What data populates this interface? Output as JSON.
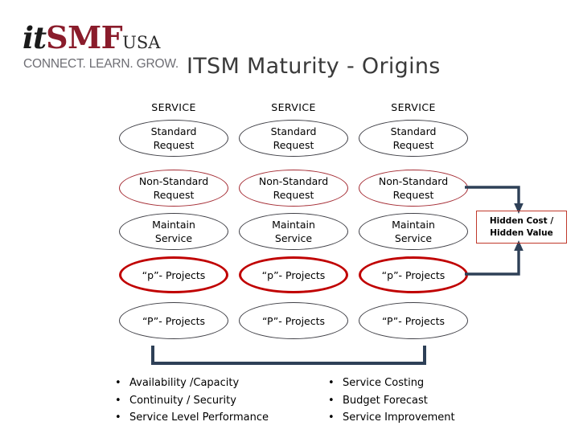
{
  "logo": {
    "part_it": "it",
    "part_smf": "SMF",
    "part_usa": "USA",
    "tagline": "CONNECT. LEARN. GROW.",
    "color_it": "#1a1a1a",
    "color_smf": "#8a1c2b",
    "color_tagline": "#6e6e74"
  },
  "title": "ITSM Maturity - Origins",
  "columns": [
    {
      "header": "SERVICE"
    },
    {
      "header": "SERVICE"
    },
    {
      "header": "SERVICE"
    }
  ],
  "rows": [
    {
      "style": "thin-black",
      "line1": "Standard",
      "line2": "Request"
    },
    {
      "style": "thin-red",
      "line1": "Non-Standard",
      "line2": "Request"
    },
    {
      "style": "thin-black",
      "line1": "Maintain",
      "line2": "Service"
    },
    {
      "style": "thick-red",
      "line1": "“p”- Projects",
      "line2": ""
    },
    {
      "style": "thin-black",
      "line1": "“P”- Projects",
      "line2": ""
    }
  ],
  "callout": {
    "line1": "Hidden Cost /",
    "line2": "Hidden Value",
    "border_color": "#c0392b"
  },
  "connector_color": "#2e4057",
  "bullets_left": [
    "Availability /Capacity",
    "Continuity / Security",
    "Service Level Performance"
  ],
  "bullets_right": [
    "Service Costing",
    "Budget Forecast",
    "Service Improvement"
  ],
  "bullet_marker": "•"
}
